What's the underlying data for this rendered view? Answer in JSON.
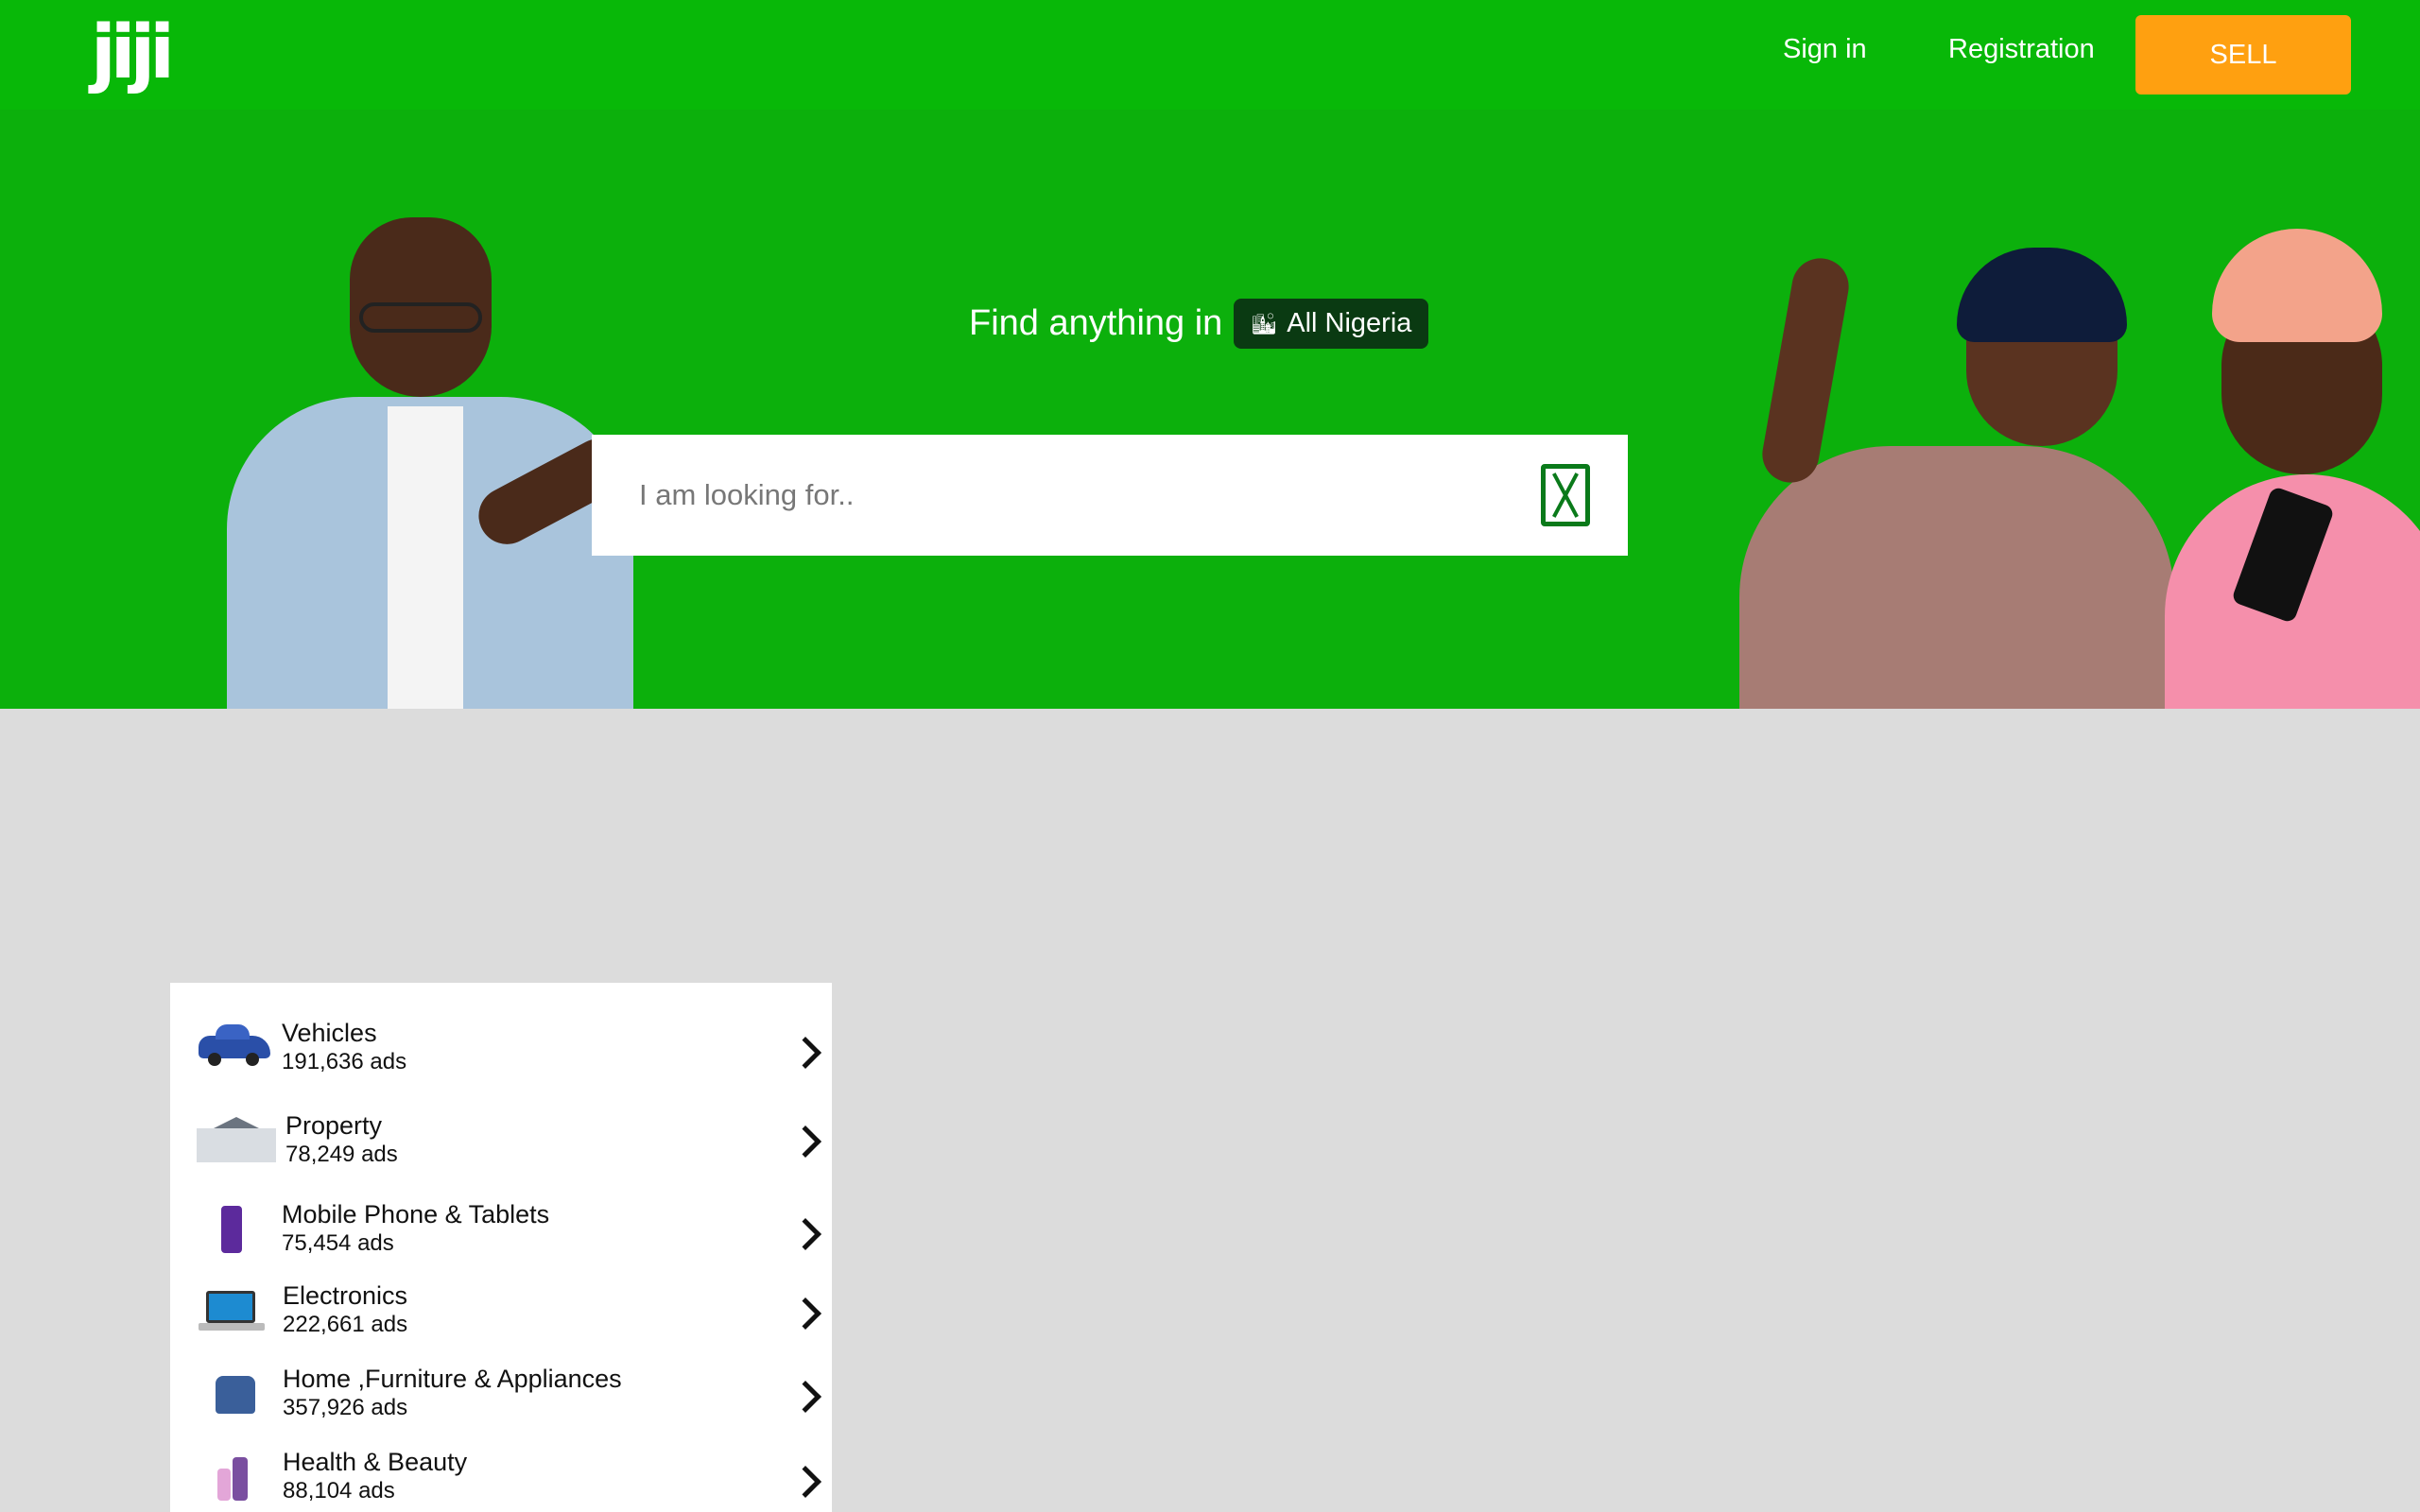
{
  "header": {
    "logo_text": "jiji",
    "signin_label": "Sign in",
    "registration_label": "Registration",
    "sell_label": "SELL"
  },
  "hero": {
    "title": "Find anything in",
    "location_label": "All Nigeria",
    "search_placeholder": "I am looking for.."
  },
  "categories": [
    {
      "name": "Vehicles",
      "count": "191,636 ads",
      "icon": "car-icon"
    },
    {
      "name": "Property",
      "count": "78,249 ads",
      "icon": "house-icon"
    },
    {
      "name": "Mobile Phone & Tablets",
      "count": "75,454 ads",
      "icon": "phone-icon"
    },
    {
      "name": "Electronics",
      "count": "222,661 ads",
      "icon": "laptop-icon"
    },
    {
      "name": "Home ,Furniture & Appliances",
      "count": "357,926 ads",
      "icon": "chair-icon"
    },
    {
      "name": "Health & Beauty",
      "count": "88,104 ads",
      "icon": "cosmetics-icon"
    }
  ],
  "colors": {
    "brand_green": "#08b808",
    "sell_orange": "#ffa010",
    "location_badge": "#0a3a12",
    "page_background": "#dcdcdc"
  }
}
